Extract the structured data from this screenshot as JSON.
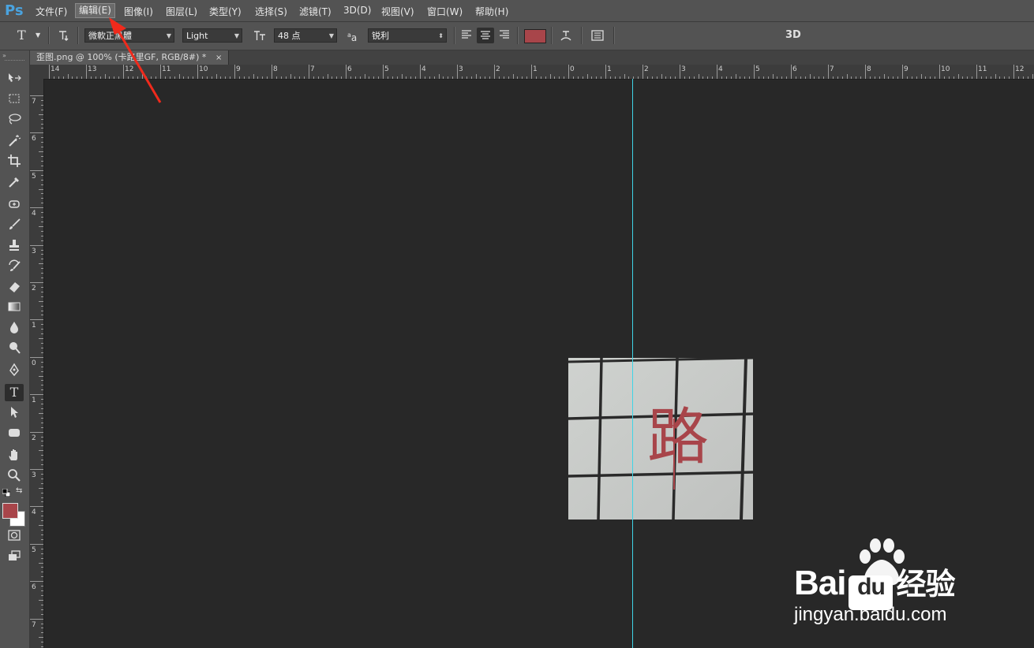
{
  "app": {
    "logo": "Ps"
  },
  "menu": {
    "items": [
      "文件(F)",
      "编辑(E)",
      "图像(I)",
      "图层(L)",
      "类型(Y)",
      "选择(S)",
      "滤镜(T)",
      "3D(D)",
      "视图(V)",
      "窗口(W)",
      "帮助(H)"
    ]
  },
  "options": {
    "font_family": "微軟正黑體",
    "font_style": "Light",
    "font_size": "48 点",
    "antialias": "锐利",
    "color": "#a8454a",
    "label_3d": "3D"
  },
  "document": {
    "tab_title": "歪图.png @ 100% (卡路里GF, RGB/8#) *",
    "tab_close": "×"
  },
  "rulers": {
    "h_ticks": [
      "14",
      "13",
      "12",
      "11",
      "10",
      "9",
      "8",
      "7",
      "6",
      "5",
      "4",
      "3",
      "2",
      "1",
      "0",
      "1",
      "2",
      "3",
      "4",
      "5",
      "6",
      "7",
      "8",
      "9",
      "10",
      "11",
      "12"
    ],
    "v_ticks": [
      "7",
      "6",
      "5",
      "4",
      "3",
      "2",
      "1",
      "0",
      "1",
      "2",
      "3",
      "4",
      "5",
      "6",
      "7"
    ]
  },
  "canvas": {
    "character": "路",
    "text_color": "#a8454a"
  },
  "colors": {
    "foreground": "#a8454a",
    "background": "#ffffff",
    "guide": "#3fd4e6",
    "annotation_arrow": "#f02a1c"
  },
  "watermark": {
    "brand": "Bai",
    "brand_du": "du",
    "brand_cn": "经验",
    "url": "jingyan.baidu.com"
  }
}
